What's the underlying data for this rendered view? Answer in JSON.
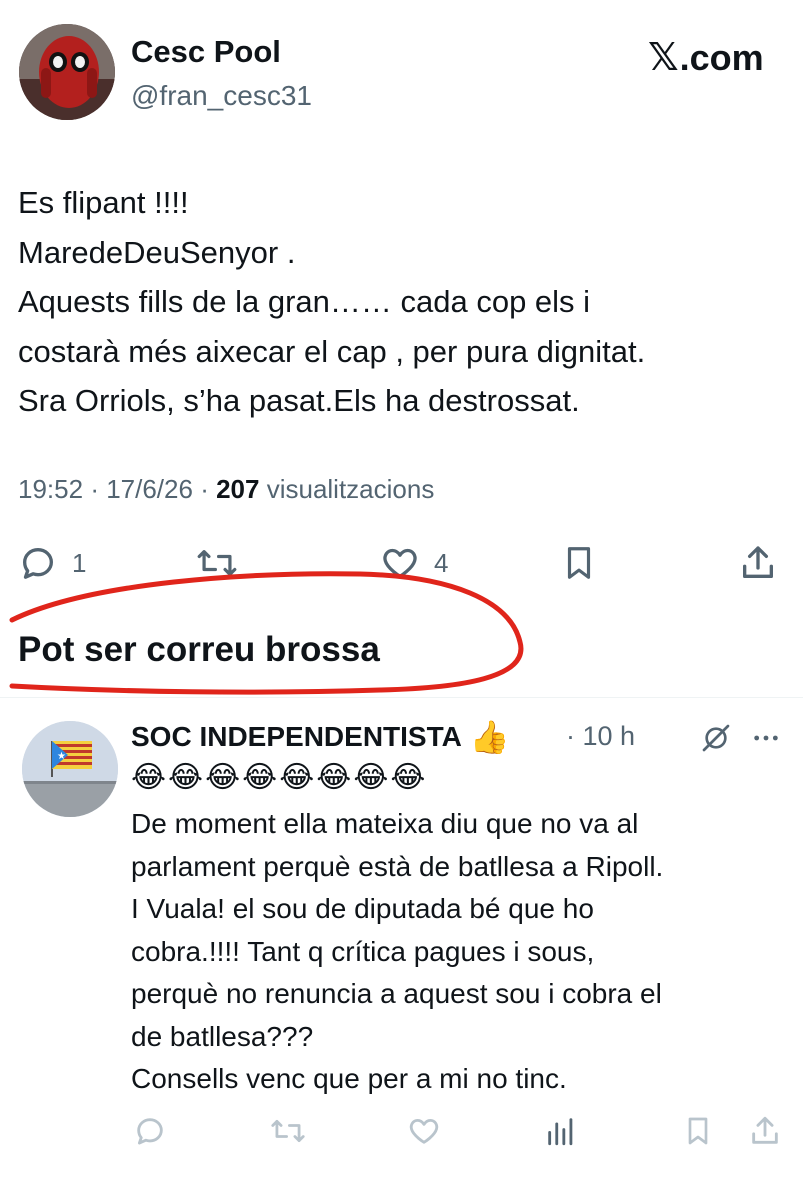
{
  "tweet": {
    "author_name": "Cesc Pool",
    "author_handle": "@fran_cesc31",
    "brand": ".com",
    "body_lines": [
      "Es flipant !!!!",
      "MaredeDeuSenyor .",
      "Aquests fills de la gran…… cada cop els i",
      "costarà més aixecar el cap , per pura dignitat.",
      "Sra Orriols, s’ha pasat.Els ha destrossat."
    ],
    "time": "19:52",
    "date": "17/6/26",
    "views_count": "207",
    "views_label": "visualitzacions",
    "replies_count": "1",
    "likes_count": "4",
    "icons": [
      "reply-icon",
      "retweet-icon",
      "like-icon",
      "bookmark-icon",
      "share-icon"
    ]
  },
  "section": {
    "heading": "Pot ser correu brossa",
    "annotation_color": "#e0251b"
  },
  "reply": {
    "author_name": "SOC INDEPENDENTISTA",
    "name_emoji": "👍",
    "time": "· 10 h",
    "emojis": "😂😂😂😂😂😂😂😂",
    "body_lines": [
      "De moment ella mateixa diu que no va al",
      "parlament perquè està de batllesa a Ripoll.",
      "I Vuala! el sou de diputada bé que ho",
      "cobra.!!!! Tant q crítica pagues i sous,",
      "perquè no renuncia a aquest sou i cobra el",
      "de batllesa???",
      "Consells venc que per a mi no tinc."
    ],
    "icons": [
      "grok-icon",
      "more-icon",
      "reply-icon",
      "retweet-icon",
      "like-icon",
      "views-icon",
      "bookmark-icon",
      "share-icon"
    ]
  },
  "colors": {
    "text": "#0f1419",
    "muted": "#536471",
    "faded_icons": "#b9c4cc",
    "divider": "#eff3f4"
  }
}
